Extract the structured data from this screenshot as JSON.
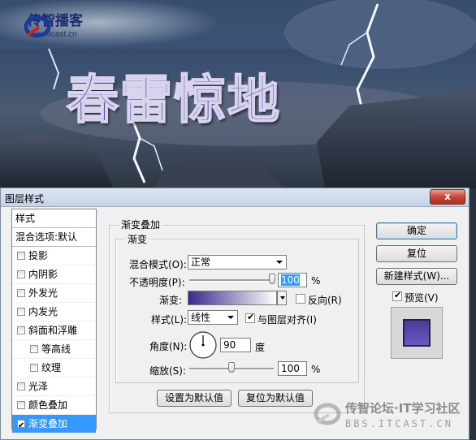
{
  "banner": {
    "logo_name": "传智播客",
    "logo_url": "www.itcast.cn",
    "headline": "春雷惊地"
  },
  "dialog": {
    "title": "图层样式",
    "close_label": "x",
    "styles_list": {
      "header": "样式",
      "blend_options": "混合选项:默认",
      "items": [
        {
          "label": "投影",
          "checked": false
        },
        {
          "label": "内阴影",
          "checked": false
        },
        {
          "label": "外发光",
          "checked": false
        },
        {
          "label": "内发光",
          "checked": false
        },
        {
          "label": "斜面和浮雕",
          "checked": false
        },
        {
          "label": "等高线",
          "checked": false
        },
        {
          "label": "纹理",
          "checked": false
        },
        {
          "label": "光泽",
          "checked": false
        },
        {
          "label": "颜色叠加",
          "checked": false
        },
        {
          "label": "渐变叠加",
          "checked": true
        }
      ]
    },
    "gradient_overlay": {
      "group_title": "渐变叠加",
      "subgroup_title": "渐变",
      "blend_mode_label": "混合模式(O):",
      "blend_mode_value": "正常",
      "opacity_label": "不透明度(P):",
      "opacity_value": "100",
      "opacity_unit": "%",
      "opacity_level": 1.0,
      "gradient_label": "渐变:",
      "reverse_label": "反向(R)",
      "reverse_checked": false,
      "style_label": "样式(L):",
      "style_value": "线性",
      "align_label": "与图层对齐(I)",
      "align_checked": true,
      "angle_label": "角度(N):",
      "angle_value": "90",
      "angle_unit": "度",
      "scale_label": "缩放(S):",
      "scale_value": "100",
      "scale_unit": "%",
      "scale_level": 0.5,
      "make_default": "设置为默认值",
      "reset_default": "复位为默认值"
    },
    "buttons": {
      "ok": "确定",
      "reset": "复位",
      "new_style": "新建样式(W)...",
      "preview": "预览(V)",
      "preview_checked": true
    }
  },
  "watermark": {
    "line1": "传智论坛·IT学习社区",
    "line2": "BBS.ITCAST.CN"
  },
  "colors": {
    "headline": "#5a4aa8",
    "gradient_start": "#3a2a8a",
    "gradient_end": "#ffffff",
    "selection": "#3399ff"
  }
}
